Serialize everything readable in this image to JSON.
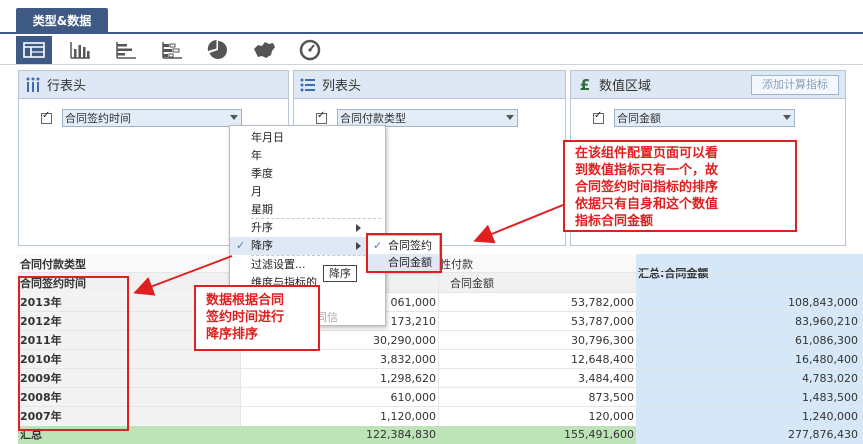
{
  "tabs": {
    "active_label": "类型&数据"
  },
  "chart_toolbar": {
    "icons": [
      "table-icon",
      "column-chart-icon",
      "bar-chart-icon",
      "stacked-bar-icon",
      "pie-chart-icon",
      "map-icon",
      "gauge-icon"
    ]
  },
  "panels": {
    "row_header": {
      "title": "行表头",
      "field": "合同签约时间"
    },
    "column_header": {
      "title": "列表头",
      "field": "合同付款类型"
    },
    "value_area": {
      "title": "数值区域",
      "field": "合同金额",
      "add_button": "添加计算指标"
    }
  },
  "dropdown_menu": {
    "items": [
      "年月日",
      "年",
      "季度",
      "月",
      "星期",
      "升序",
      "降序",
      "过滤设置...",
      "维度与指标的",
      "同信"
    ],
    "selected": "降序"
  },
  "submenu": {
    "items": [
      "合同签约",
      "合同金额"
    ]
  },
  "tooltip": {
    "text": "降序"
  },
  "table": {
    "col_type_label": "合同付款类型",
    "row_dim_label": "合同签约时间",
    "pay_header_partial": "性付款",
    "measure_header": "合同金额",
    "total_header": "汇总:合同金额",
    "rows": [
      {
        "year": "2013年",
        "col1": "061,000",
        "col2": "53,782,000",
        "total": "108,843,000"
      },
      {
        "year": "2012年",
        "col1": "173,210",
        "col2": "53,787,000",
        "total": "83,960,210"
      },
      {
        "year": "2011年",
        "col1": "30,290,000",
        "col2": "30,796,300",
        "total": "61,086,300"
      },
      {
        "year": "2010年",
        "col1": "3,832,000",
        "col2": "12,648,400",
        "total": "16,480,400"
      },
      {
        "year": "2009年",
        "col1": "1,298,620",
        "col2": "3,484,400",
        "total": "4,783,020"
      },
      {
        "year": "2008年",
        "col1": "610,000",
        "col2": "873,500",
        "total": "1,483,500"
      },
      {
        "year": "2007年",
        "col1": "1,120,000",
        "col2": "120,000",
        "total": "1,240,000"
      }
    ],
    "summary": {
      "label": "汇总",
      "col1": "122,384,830",
      "col2": "155,491,600",
      "total": "277,876,430"
    }
  },
  "annotations": {
    "right": [
      "在该组件配置页面可以看",
      "到数值指标只有一个，故",
      "合同签约时间指标的排序",
      "依据只有自身和这个数值",
      "指标合同金额"
    ],
    "left": [
      "数据根据合同",
      "签约时间进行",
      "降序排序"
    ]
  },
  "colors": {
    "accent": "#3e5a84",
    "annotation": "#e02020",
    "summary_bg": "#bfe3b8",
    "total_bg": "#d6e8f8"
  }
}
